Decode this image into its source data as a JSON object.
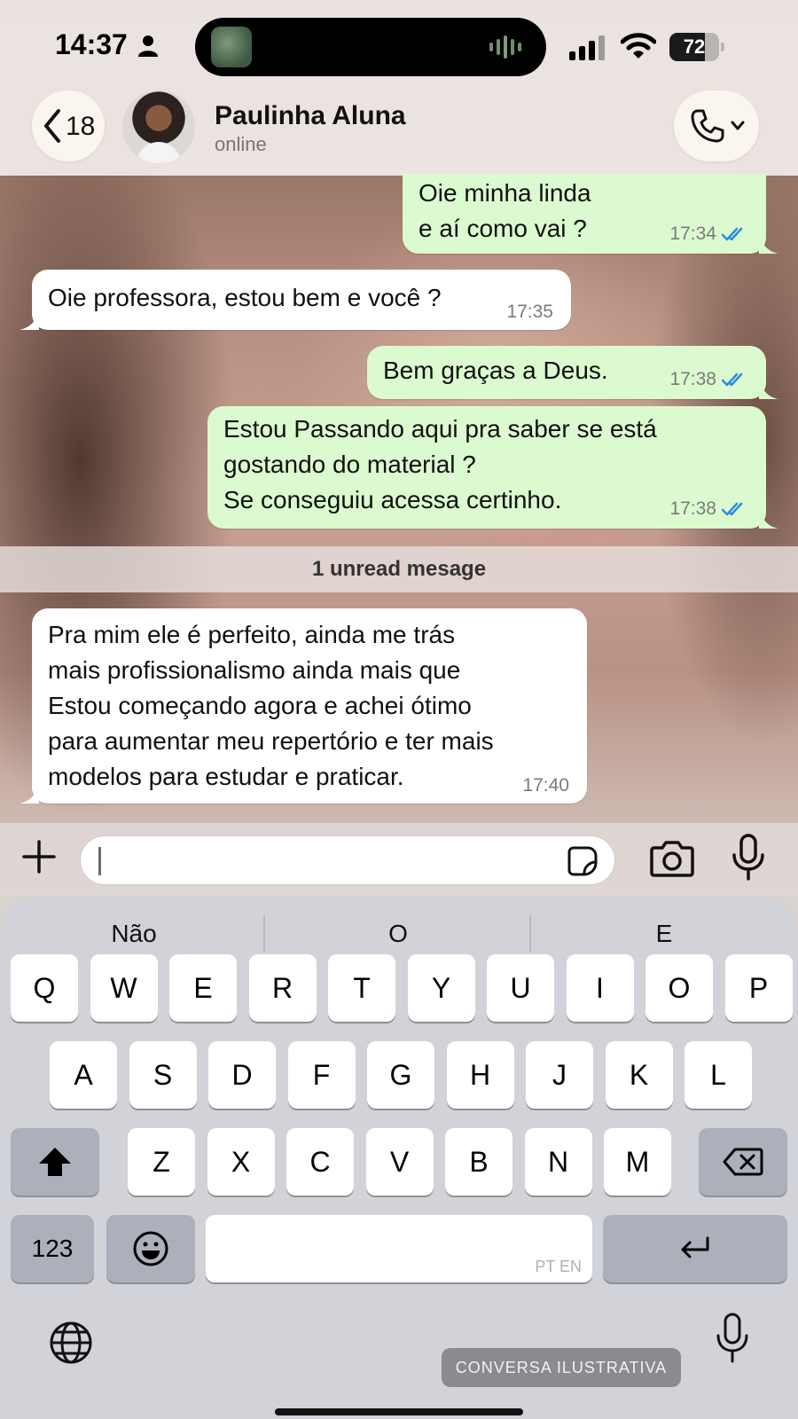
{
  "status_bar": {
    "time": "14:37",
    "battery_level": 72,
    "battery_label": "72"
  },
  "header": {
    "back_count": "18",
    "contact_name": "Paulinha Aluna",
    "contact_status": "online"
  },
  "messages": [
    {
      "direction": "out",
      "text": "Oie minha linda\ne aí como vai ?",
      "time": "17:34",
      "read": true
    },
    {
      "direction": "in",
      "text": "Oie professora, estou bem e você ?",
      "time": "17:35"
    },
    {
      "direction": "out",
      "text": "Bem graças a Deus.",
      "time": "17:38",
      "read": true
    },
    {
      "direction": "out",
      "text": "Estou Passando aqui pra saber se está\ngostando do material ?\nSe conseguiu acessa certinho.",
      "time": "17:38",
      "read": true
    },
    {
      "direction": "in",
      "text": "Pra mim ele é perfeito, ainda me trás\nmais profissionalismo ainda mais que\nEstou começando agora e achei ótimo\npara aumentar meu repertório e ter mais\nmodelos para estudar e praticar.",
      "time": "17:40"
    }
  ],
  "unread_banner": "1 unread mesage",
  "input": {
    "value": "",
    "placeholder": ""
  },
  "keyboard": {
    "suggestions": [
      "Não",
      "O",
      "E"
    ],
    "row1": [
      "Q",
      "W",
      "E",
      "R",
      "T",
      "Y",
      "U",
      "I",
      "O",
      "P"
    ],
    "row2": [
      "A",
      "S",
      "D",
      "F",
      "G",
      "H",
      "J",
      "K",
      "L"
    ],
    "row3": [
      "Z",
      "X",
      "C",
      "V",
      "B",
      "N",
      "M"
    ],
    "numbers_label": "123",
    "space_hint": "PT EN"
  },
  "watermark": "CONVERSA ILUSTRATIVA",
  "colors": {
    "outgoing_bubble": "#dcfad0",
    "incoming_bubble": "#ffffff",
    "read_ticks": "#2f8be0"
  },
  "icons": [
    "person-icon",
    "signal-icon",
    "wifi-icon",
    "battery-icon",
    "chevron-left-icon",
    "phone-icon",
    "chevron-down-icon",
    "double-check-icon",
    "plus-icon",
    "sticker-icon",
    "camera-icon",
    "microphone-icon",
    "shift-icon",
    "backspace-icon",
    "emoji-icon",
    "return-icon",
    "globe-icon"
  ]
}
